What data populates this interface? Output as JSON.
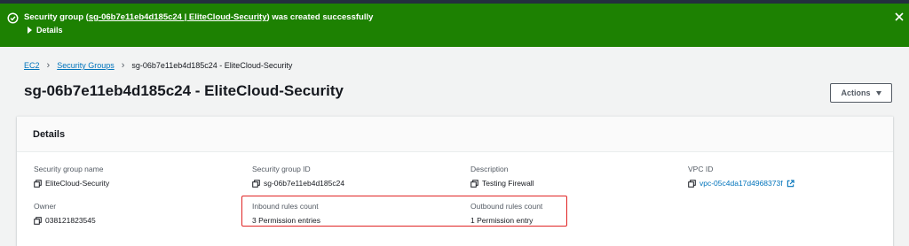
{
  "flash": {
    "message_prefix": "Security group (",
    "message_link": "sg-06b7e11eb4d185c24 | EliteCloud-Security",
    "message_suffix": ") was created successfully",
    "details_label": "Details"
  },
  "breadcrumb": {
    "items": [
      "EC2",
      "Security Groups"
    ],
    "current": "sg-06b7e11eb4d185c24 - EliteCloud-Security"
  },
  "page": {
    "title": "sg-06b7e11eb4d185c24 - EliteCloud-Security",
    "actions_label": "Actions"
  },
  "details": {
    "heading": "Details",
    "fields": {
      "sg_name": {
        "label": "Security group name",
        "value": "EliteCloud-Security"
      },
      "sg_id": {
        "label": "Security group ID",
        "value": "sg-06b7e11eb4d185c24"
      },
      "description": {
        "label": "Description",
        "value": "Testing Firewall"
      },
      "vpc_id": {
        "label": "VPC ID",
        "value": "vpc-05c4da17d4968373f"
      },
      "owner": {
        "label": "Owner",
        "value": "038121823545"
      },
      "inbound": {
        "label": "Inbound rules count",
        "value": "3 Permission entries"
      },
      "outbound": {
        "label": "Outbound rules count",
        "value": "1 Permission entry"
      }
    }
  },
  "colors": {
    "success_green": "#1d8102",
    "link_blue": "#0073bb",
    "highlight_red": "#e02424"
  }
}
